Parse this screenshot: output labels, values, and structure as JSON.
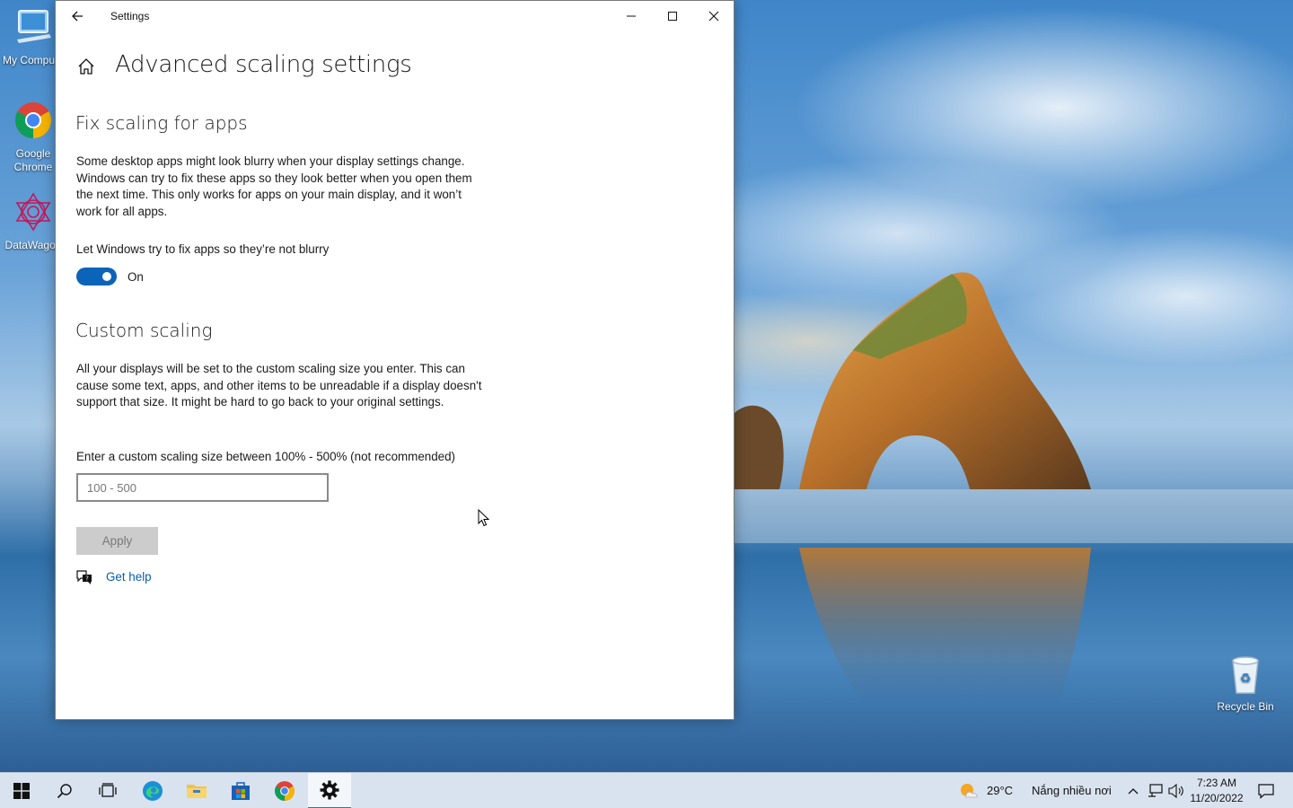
{
  "desktop": {
    "icons": [
      {
        "label": "My Compute",
        "icon": "computer-icon"
      },
      {
        "label": "Google Chrome",
        "icon": "chrome-icon"
      },
      {
        "label": "DataWagon",
        "icon": "datawagon-icon"
      }
    ],
    "recycle_bin": {
      "label": "Recycle Bin",
      "icon": "recycle-bin-icon"
    }
  },
  "window": {
    "title": "Settings",
    "page_title": "Advanced scaling settings",
    "fix_section": {
      "title": "Fix scaling for apps",
      "description": "Some desktop apps might look blurry when your display settings change. Windows can try to fix these apps so they look better when you open them the next time. This only works for apps on your main display, and it won’t work for all apps.",
      "toggle_label": "Let Windows try to fix apps so they’re not blurry",
      "toggle_state": "On",
      "toggle_on": true
    },
    "custom_section": {
      "title": "Custom scaling",
      "description": "All your displays will be set to the custom scaling size you enter. This can cause some text, apps, and other items to be unreadable if a display doesn't support that size. It might be hard to go back to your original settings.",
      "input_label": "Enter a custom scaling size between 100% - 500% (not recommended)",
      "input_value": "",
      "input_placeholder": "100 - 500",
      "apply_label": "Apply"
    },
    "help_link": "Get help"
  },
  "taskbar": {
    "weather_temp": "29°C",
    "weather_desc": "Nắng nhiều nơi",
    "time": "7:23 AM",
    "date": "11/20/2022"
  },
  "colors": {
    "accent": "#0a64b8",
    "link": "#0a5cb0",
    "taskbar": "#d9e3ef"
  }
}
